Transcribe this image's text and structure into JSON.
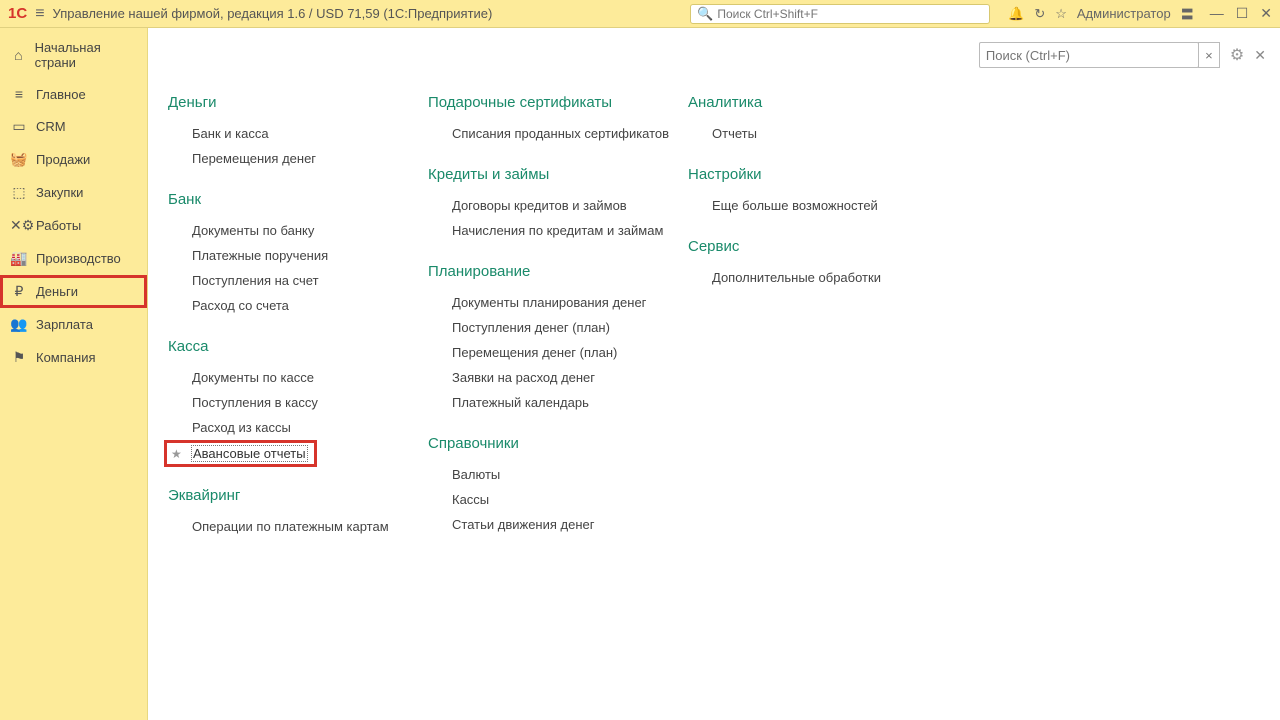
{
  "titlebar": {
    "title": "Управление нашей фирмой, редакция 1.6 / USD 71,59  (1С:Предприятие)",
    "search_placeholder": "Поиск Ctrl+Shift+F",
    "user": "Администратор"
  },
  "sidebar": {
    "items": [
      {
        "icon": "⌂",
        "label": "Начальная страни"
      },
      {
        "icon": "≡",
        "label": "Главное"
      },
      {
        "icon": "▭",
        "label": "CRM"
      },
      {
        "icon": "🧺",
        "label": "Продажи"
      },
      {
        "icon": "⬚",
        "label": "Закупки"
      },
      {
        "icon": "✕⚙",
        "label": "Работы"
      },
      {
        "icon": "🏭",
        "label": "Производство"
      },
      {
        "icon": "₽",
        "label": "Деньги"
      },
      {
        "icon": "👥",
        "label": "Зарплата"
      },
      {
        "icon": "⚑",
        "label": "Компания"
      }
    ]
  },
  "main": {
    "search_placeholder": "Поиск (Ctrl+F)",
    "col1": [
      {
        "head": "Деньги",
        "links": [
          "Банк и касса",
          "Перемещения денег"
        ]
      },
      {
        "head": "Банк",
        "links": [
          "Документы по банку",
          "Платежные поручения",
          "Поступления на счет",
          "Расход со счета"
        ]
      },
      {
        "head": "Касса",
        "links": [
          "Документы по кассе",
          "Поступления в кассу",
          "Расход из кассы",
          "Авансовые отчеты"
        ]
      },
      {
        "head": "Эквайринг",
        "links": [
          "Операции по платежным картам"
        ]
      }
    ],
    "col2": [
      {
        "head": "Подарочные сертификаты",
        "links": [
          "Списания проданных сертификатов"
        ]
      },
      {
        "head": "Кредиты и займы",
        "links": [
          "Договоры кредитов и займов",
          "Начисления по кредитам и займам"
        ]
      },
      {
        "head": "Планирование",
        "links": [
          "Документы планирования денег",
          "Поступления денег (план)",
          "Перемещения денег (план)",
          "Заявки на расход денег",
          "Платежный календарь"
        ]
      },
      {
        "head": "Справочники",
        "links": [
          "Валюты",
          "Кассы",
          "Статьи движения денег"
        ]
      }
    ],
    "col3": [
      {
        "head": "Аналитика",
        "links": [
          "Отчеты"
        ]
      },
      {
        "head": "Настройки",
        "links": [
          "Еще больше возможностей"
        ]
      },
      {
        "head": "Сервис",
        "links": [
          "Дополнительные обработки"
        ]
      }
    ]
  }
}
